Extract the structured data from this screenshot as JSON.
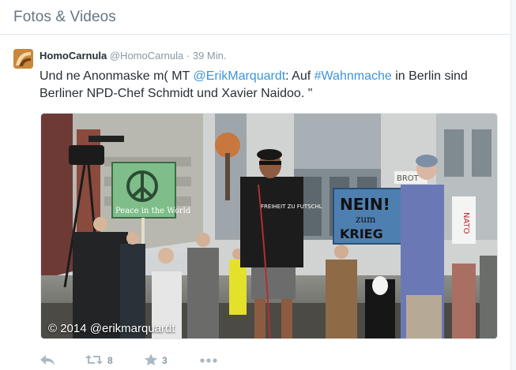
{
  "section": {
    "title": "Fotos & Videos"
  },
  "tweet": {
    "fullname": "HomoCarnula",
    "username": "@HomoCarnula",
    "separator": "·",
    "timestamp": "39 Min.",
    "text_parts": {
      "p1": "Und ne Anonmaske m( MT ",
      "mention": "@ErikMarquardt",
      "p2": ": Auf ",
      "hashtag": "#Wahnmache",
      "p3": " in Berlin sind Berliner NPD-Chef Schmidt und Xavier Naidoo.  \""
    },
    "media": {
      "watermark": "© 2014 @erikmarquardt",
      "signs": {
        "peace": "Peace in the World",
        "nein": "NEIN!",
        "zum": "zum",
        "krieg": "KRIEG",
        "brot": "BROT",
        "nato": "NATO",
        "shirt": "FREIHEIT ZU FUTSCHL"
      }
    },
    "actions": {
      "reply_icon": "reply-icon",
      "retweet_icon": "retweet-icon",
      "retweet_count": "8",
      "favorite_icon": "star-icon",
      "favorite_count": "3",
      "more_icon": "more-icon"
    }
  },
  "colors": {
    "link": "#3b94d9",
    "text": "#292f33",
    "muted": "#8899a6",
    "action_icon": "#aab8c2"
  }
}
